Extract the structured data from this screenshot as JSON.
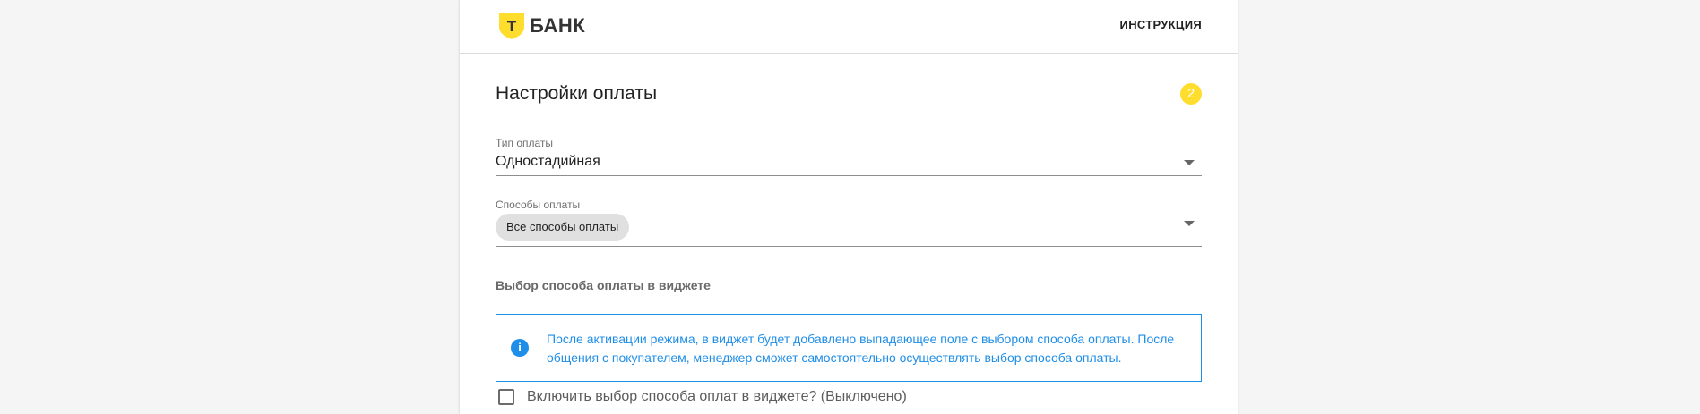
{
  "colors": {
    "brand_yellow": "#ffdd2d",
    "info_blue": "#1f8ee8",
    "page_background": "#f5f5f5"
  },
  "header": {
    "logo_letter": "Т",
    "logo_text": "БАНК",
    "instructions_link": "ИНСТРУКЦИЯ"
  },
  "section": {
    "title": "Настройки оплаты",
    "step_number": "2"
  },
  "payment_type": {
    "label": "Тип оплаты",
    "value": "Одностадийная"
  },
  "payment_methods": {
    "label": "Способы оплаты",
    "selected_chip": "Все способы оплаты"
  },
  "widget_selection": {
    "heading": "Выбор способа оплаты в виджете",
    "info_icon": "info-icon",
    "info_text": "После активации режима, в виджет будет добавлено выпадающее поле с выбором способа оплаты. После общения с покупателем, менеджер сможет самостоятельно осуществлять выбор способа оплаты.",
    "checkbox_label": "Включить выбор способа оплат в виджете? (Выключено)",
    "checkbox_checked": false
  }
}
